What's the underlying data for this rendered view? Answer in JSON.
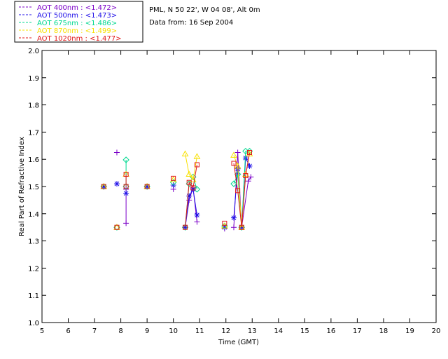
{
  "header": {
    "site": "PML, N 50 22', W 04 08', Alt 0m",
    "date_line": "Data from: 16 Sep 2004"
  },
  "chart_data": {
    "type": "scatter",
    "xlabel": "Time (GMT)",
    "ylabel": "Real Part of Refractive Index",
    "xlim": [
      5,
      20
    ],
    "ylim": [
      1.0,
      2.0
    ],
    "xticks": [
      "5",
      "6",
      "7",
      "8",
      "9",
      "10",
      "11",
      "12",
      "13",
      "14",
      "15",
      "16",
      "17",
      "18",
      "19",
      "20"
    ],
    "yticks": [
      "1.0",
      "1.1",
      "1.2",
      "1.3",
      "1.4",
      "1.5",
      "1.6",
      "1.7",
      "1.8",
      "1.9",
      "2.0"
    ],
    "grid": false,
    "legend_position": "top-left",
    "series": [
      {
        "name": "AOT  400nm : <1.472>",
        "color": "#7b00c8",
        "marker": "plus",
        "points": [
          [
            7.35,
            1.5
          ],
          [
            7.85,
            1.625
          ],
          [
            8.2,
            1.365
          ],
          [
            8.2,
            1.49
          ],
          [
            9.0,
            1.5
          ],
          [
            10.0,
            1.49
          ],
          [
            10.45,
            1.35
          ],
          [
            10.6,
            1.45
          ],
          [
            10.75,
            1.495
          ],
          [
            10.9,
            1.37
          ],
          [
            11.95,
            1.345
          ],
          [
            12.3,
            1.35
          ],
          [
            12.45,
            1.625
          ],
          [
            12.6,
            1.35
          ],
          [
            12.85,
            1.52
          ],
          [
            12.95,
            1.535
          ]
        ]
      },
      {
        "name": "AOT  500nm : <1.473>",
        "color": "#2010e8",
        "marker": "asterisk",
        "points": [
          [
            7.35,
            1.5
          ],
          [
            7.85,
            1.51
          ],
          [
            8.2,
            1.475
          ],
          [
            9.0,
            1.5
          ],
          [
            10.0,
            1.505
          ],
          [
            10.45,
            1.35
          ],
          [
            10.6,
            1.465
          ],
          [
            10.75,
            1.49
          ],
          [
            10.9,
            1.395
          ],
          [
            11.95,
            1.35
          ],
          [
            12.3,
            1.385
          ],
          [
            12.45,
            1.565
          ],
          [
            12.6,
            1.35
          ],
          [
            12.75,
            1.605
          ],
          [
            12.9,
            1.575
          ]
        ]
      },
      {
        "name": "AOT  675nm : <1.486>",
        "color": "#00d890",
        "marker": "diamond",
        "points": [
          [
            7.35,
            1.5
          ],
          [
            7.85,
            1.35
          ],
          [
            8.2,
            1.598
          ],
          [
            8.2,
            1.5
          ],
          [
            9.0,
            1.5
          ],
          [
            10.0,
            1.515
          ],
          [
            10.45,
            1.35
          ],
          [
            10.6,
            1.51
          ],
          [
            10.75,
            1.535
          ],
          [
            10.9,
            1.49
          ],
          [
            11.95,
            1.355
          ],
          [
            12.3,
            1.51
          ],
          [
            12.45,
            1.545
          ],
          [
            12.6,
            1.35
          ],
          [
            12.75,
            1.63
          ],
          [
            12.9,
            1.63
          ]
        ]
      },
      {
        "name": "AOT  870nm : <1.499>",
        "color": "#f8e000",
        "marker": "triangle",
        "points": [
          [
            7.35,
            1.5
          ],
          [
            7.85,
            1.35
          ],
          [
            8.2,
            1.545
          ],
          [
            9.0,
            1.5
          ],
          [
            10.0,
            1.525
          ],
          [
            10.45,
            1.62
          ],
          [
            10.6,
            1.545
          ],
          [
            10.75,
            1.525
          ],
          [
            10.9,
            1.61
          ],
          [
            11.95,
            1.355
          ],
          [
            12.3,
            1.615
          ],
          [
            12.45,
            1.575
          ],
          [
            12.6,
            1.35
          ],
          [
            12.75,
            1.545
          ],
          [
            12.9,
            1.62
          ]
        ]
      },
      {
        "name": "AOT 1020nm : <1.477>",
        "color": "#e01818",
        "marker": "square",
        "points": [
          [
            7.35,
            1.5
          ],
          [
            7.85,
            1.35
          ],
          [
            8.2,
            1.545
          ],
          [
            8.2,
            1.5
          ],
          [
            9.0,
            1.5
          ],
          [
            10.0,
            1.53
          ],
          [
            10.45,
            1.35
          ],
          [
            10.6,
            1.515
          ],
          [
            10.75,
            1.495
          ],
          [
            10.9,
            1.58
          ],
          [
            11.95,
            1.365
          ],
          [
            12.3,
            1.585
          ],
          [
            12.45,
            1.485
          ],
          [
            12.6,
            1.35
          ],
          [
            12.75,
            1.54
          ],
          [
            12.9,
            1.625
          ]
        ]
      }
    ]
  }
}
